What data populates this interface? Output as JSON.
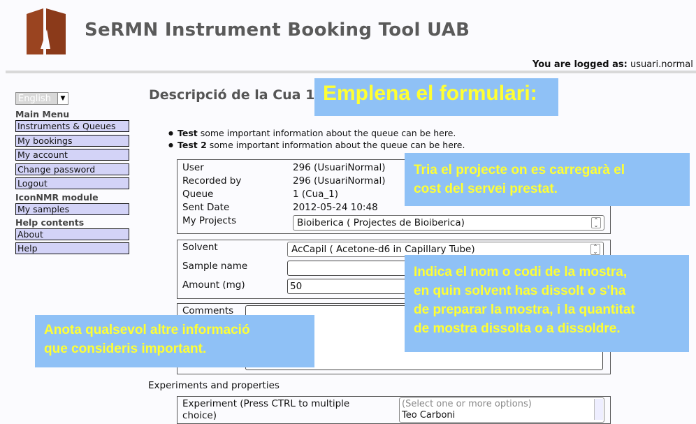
{
  "header": {
    "title": "SeRMN Instrument Booking Tool UAB",
    "logged_label": "You are logged as:",
    "logged_user": "usuari.normal"
  },
  "sidebar": {
    "language": "English",
    "main_menu_heading": "Main Menu",
    "main_items": [
      "Instruments & Queues",
      "My bookings",
      "My account",
      "Change password",
      "Logout"
    ],
    "iconnmr_heading": "IconNMR module",
    "iconnmr_items": [
      "My samples"
    ],
    "help_heading": "Help contents",
    "help_items": [
      "About",
      "Help"
    ]
  },
  "main": {
    "title": "Descripció de la Cua 1",
    "bullets": [
      {
        "bold": "Test",
        "text": " some important information about the queue can be here."
      },
      {
        "bold": "Test 2",
        "text": " some important information about the queue can be here."
      }
    ],
    "info": {
      "user_label": "User",
      "user_value": "296 (UsuariNormal)",
      "recorded_label": "Recorded by",
      "recorded_value": "296 (UsuariNormal)",
      "queue_label": "Queue",
      "queue_value": "1 (Cua_1)",
      "sent_label": "Sent Date",
      "sent_value": "2012-05-24 10:48",
      "projects_label": "My Projects",
      "projects_value": "Bioiberica ( Projectes de Bioiberica)"
    },
    "sample": {
      "solvent_label": "Solvent",
      "solvent_value": "AcCapil ( Acetone-d6 in Capillary Tube)",
      "name_label": "Sample name",
      "name_value": "",
      "amount_label": "Amount (mg)",
      "amount_value": "50"
    },
    "comments_label": "Comments",
    "experiments_heading": "Experiments and properties",
    "experiment_label_1": "Experiment (Press CTRL to multiple",
    "experiment_label_2": "choice)",
    "experiment_options": [
      "(Select one or more options)",
      "Teo Carboni"
    ]
  },
  "overlays": {
    "title": "Emplena el formulari:",
    "projects_hint": [
      "Tria el projecte on es carregarà el",
      "cost del servei prestat."
    ],
    "sample_hint": [
      "Indica el nom o codi de la mostra,",
      "en quin solvent has dissolt o s'ha",
      "de preparar la mostra, i la quantitat",
      "de mostra dissolta o a dissoldre."
    ],
    "comments_hint": [
      "Anota qualsevol altre informació",
      "que consideris important."
    ]
  },
  "colors": {
    "nav_bg": "#d3d3f7",
    "overlay_bg": "#8fc1f6",
    "overlay_text": "#ffff33",
    "logo": "#8b3f1f"
  }
}
